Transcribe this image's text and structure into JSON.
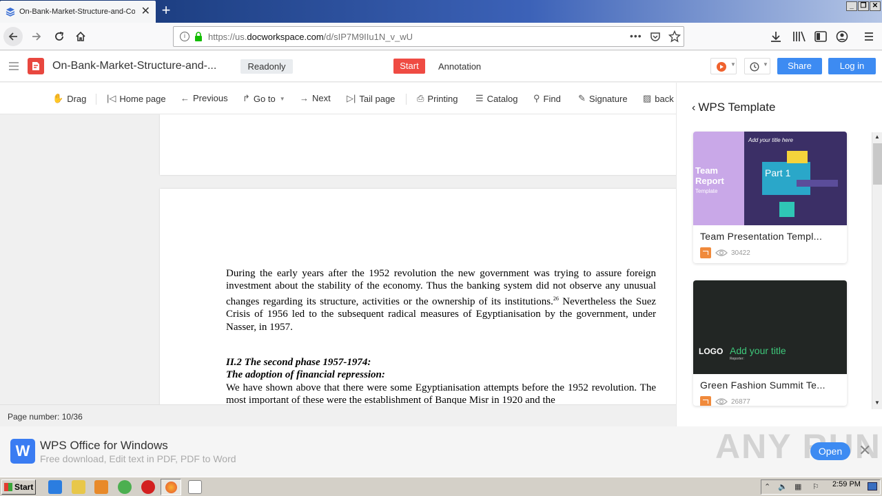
{
  "browser": {
    "tab_title": "On-Bank-Market-Structure-and-Co",
    "url_prefix": "https://us.",
    "url_domain": "docworkspace.com",
    "url_path": "/d/sIP7M9IIu1N_v_wU"
  },
  "header": {
    "doc_title": "On-Bank-Market-Structure-and-...",
    "readonly_label": "Readonly",
    "start_label": "Start",
    "annotation_label": "Annotation",
    "share_label": "Share",
    "login_label": "Log in"
  },
  "toolbar": {
    "drag": "Drag",
    "home_page": "Home page",
    "previous": "Previous",
    "go_to": "Go to",
    "next": "Next",
    "tail_page": "Tail page",
    "printing": "Printing",
    "catalog": "Catalog",
    "find": "Find",
    "signature": "Signature",
    "back": "back"
  },
  "document": {
    "para1": "During the early years after the 1952 revolution the new government was trying to assure foreign investment about the stability of the economy. Thus the banking system did not observe any unusual changes regarding its structure, activities or the ownership of its institutions.",
    "para1_footnote": "26",
    "para1_cont": "Nevertheless the Suez Crisis of 1956 led to the subsequent radical measures of Egyptianisation by the government, under Nasser, in 1957.",
    "heading1": "II.2 The second phase 1957-1974:",
    "heading2": "The adoption of financial repression:",
    "para2": "We have shown above that there were some Egyptianisation attempts before the 1952 revolution. The most important of these were the establishment of Banque Misr in 1920 and the"
  },
  "status": {
    "page_number": "Page number: 10/36"
  },
  "side_panel": {
    "title": "WPS Template",
    "cards": [
      {
        "title": "Team Presentation Templ...",
        "views": "30422",
        "img_main": "Team",
        "img_sub": "Report",
        "img_small": "Template",
        "img_overlay": "Add  your title here",
        "img_part": "Part 1"
      },
      {
        "title": "Green Fashion Summit Te...",
        "views": "26877",
        "img_logo": "LOGO",
        "img_heading": "Add your title",
        "img_reporter": "Reporter:"
      }
    ]
  },
  "banner": {
    "logo_letter": "W",
    "title": "WPS Office for Windows",
    "subtitle": "Free download, Edit text in PDF, PDF to Word",
    "open_label": "Open",
    "watermark": "ANY RUN"
  },
  "taskbar": {
    "start_label": "Start",
    "clock": "2:59 PM"
  },
  "colors": {
    "accent_blue": "#3d8bf2",
    "brand_red": "#ef4b43",
    "card_orange": "#f08a3c"
  }
}
